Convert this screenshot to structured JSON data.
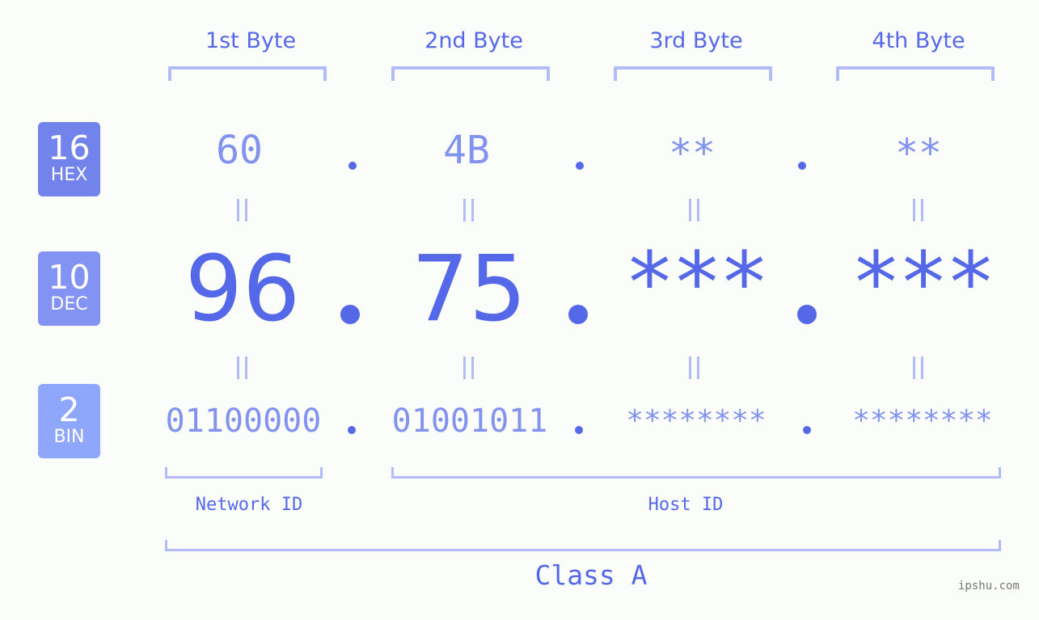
{
  "bytes": {
    "headers": [
      "1st Byte",
      "2nd Byte",
      "3rd Byte",
      "4th Byte"
    ]
  },
  "badges": {
    "hex": {
      "base": "16",
      "label": "HEX",
      "color": "#7383ec"
    },
    "dec": {
      "base": "10",
      "label": "DEC",
      "color": "#8293f3"
    },
    "bin": {
      "base": "2",
      "label": "BIN",
      "color": "#8fa7fa"
    }
  },
  "hex_values": [
    "60",
    "4B",
    "**",
    "**"
  ],
  "dec_values": [
    "96",
    "75",
    "***",
    "***"
  ],
  "bin_values": [
    "01100000",
    "01001011",
    "********",
    "********"
  ],
  "parts": {
    "network": "Network ID",
    "host": "Host ID",
    "class": "Class A"
  },
  "watermark": "ipshu.com",
  "colors": {
    "primary": "#5468e8",
    "secondary": "#8193ee",
    "bracket": "#b2bdf8",
    "background": "#fbfdfb"
  }
}
